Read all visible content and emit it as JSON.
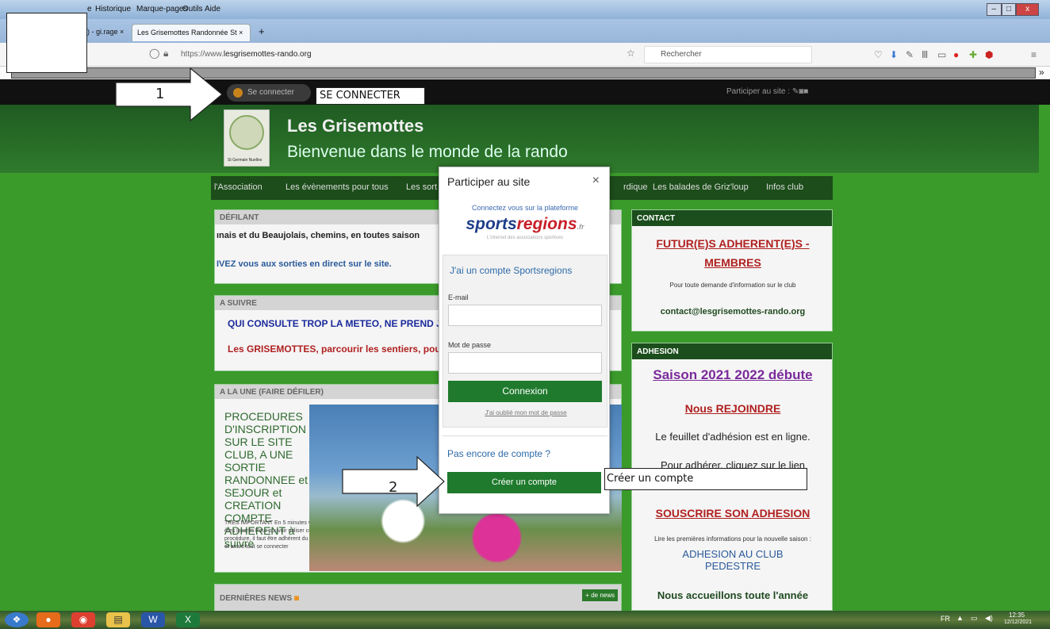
{
  "browser": {
    "menu": [
      "e",
      "Historique",
      "Marque-pages",
      "Outils",
      "Aide"
    ],
    "tabs": [
      ") - gi.rage ×",
      "Les Grisemottes Randonnée St ×",
      "+"
    ],
    "url_prefix": "https://www.",
    "url_domain": "lesgrisemottes-rando.org",
    "search_placeholder": "Rechercher",
    "overflow": "»"
  },
  "site": {
    "connect_label": "Se connecter",
    "participer": "Participer au site :",
    "title": "Les Grisemottes",
    "subtitle": "Bienvenue dans le monde de la rando",
    "logo_text": "St Germain Nuelles",
    "nav": [
      "l'Association",
      "Les évènements pour tous",
      "Les sort",
      "rdique",
      "Les balades de Griz'loup",
      "Infos club"
    ],
    "defilant": {
      "head": "DÉFILANT",
      "line1": "ınais et du Beaujolais, chemins, en toutes saison",
      "line2": "IVEZ vous aux sorties en direct sur le site."
    },
    "asuivre": {
      "head": "A SUIVRE",
      "line1": "QUI CONSULTE TROP LA METEO, NE PREND J/",
      "line2": "Les GRISEMOTTES, parcourir les sentiers, pour"
    },
    "alaune": {
      "head": "A LA UNE (FAIRE DÉFILER)",
      "title": "PROCEDURES D'INSCRIPTION SUR LE SITE CLUB, A UNE SORTIE RANDONNEE et SEJOUR et CREATION COMPTE ADHERENT à suivre",
      "body": "TRES IMPORTANT En 5 minutes vous êtes inscrits Pour pouvoir utiliser cette procédure, il faut être adhérent du club et avant tout se connecter"
    },
    "news": {
      "head": "DERNIÈRES NEWS",
      "more": "+ de news"
    },
    "contact": {
      "head": "CONTACT",
      "link": "FUTUR(E)S ADHERENT(E)S - MEMBRES",
      "info": "Pour toute demande d'information sur le club",
      "email": "contact@lesgrisemottes-rando.org"
    },
    "adhesion": {
      "head": "ADHESION",
      "saison": "Saison 2021 2022 débute",
      "rejoindre": "Nous REJOINDRE",
      "feuillet": "Le feuillet d'adhésion est en ligne.",
      "pour": "Pour adhérer, cliquez sur le lien",
      "souscrire": "SOUSCRIRE SON ADHESION",
      "lire": "Lire les premières informations pour la nouvelle saison :",
      "club": "ADHESION AU CLUB PEDESTRE",
      "accueil": "Nous accueillons toute l'année"
    }
  },
  "modal": {
    "title": "Participer au site",
    "close": "×",
    "sub": "Connectez vous sur la plateforme",
    "brand1": "sports",
    "brand2": "regions",
    "brand3": ".fr",
    "tagline": "L'internet des associations sportives",
    "account_heading": "J'ai un compte Sportsregions",
    "email_label": "E-mail",
    "password_label": "Mot de passe",
    "login": "Connexion",
    "forgot": "J'ai oublié mon mot de passe",
    "no_account": "Pas encore de compte ?",
    "create": "Créer un compte"
  },
  "annotations": {
    "n1": "1",
    "label1": "SE CONNECTER",
    "n2": "2",
    "label2": "Créer un compte"
  },
  "taskbar": {
    "lang": "FR",
    "time": "12:35",
    "date": "12/12/2021"
  }
}
